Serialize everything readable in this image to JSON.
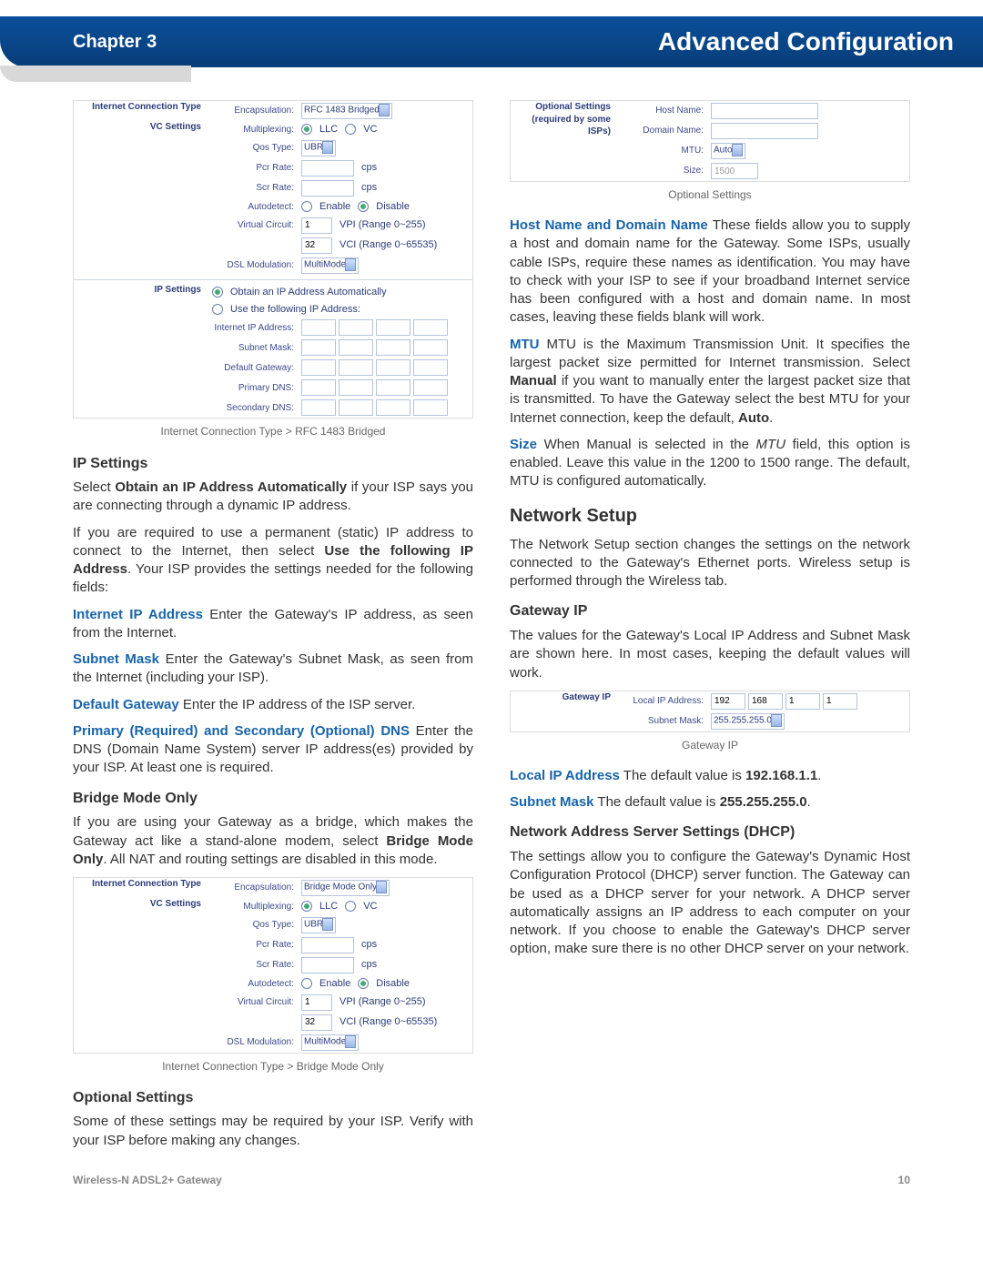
{
  "header": {
    "chapter": "Chapter 3",
    "title": "Advanced Configuration"
  },
  "fig1": {
    "side1": "Internet Connection Type",
    "side2": "VC Settings",
    "side3": "IP Settings",
    "encap_l": "Encapsulation:",
    "encap_v": "RFC 1483 Bridged",
    "mux_l": "Multiplexing:",
    "mux_llc": "LLC",
    "mux_vc": "VC",
    "qos_l": "Qos Type:",
    "qos_v": "UBR",
    "pcr_l": "Pcr Rate:",
    "rate_u": "cps",
    "scr_l": "Scr Rate:",
    "auto_l": "Autodetect:",
    "enable": "Enable",
    "disable": "Disable",
    "vc_l": "Virtual Circuit:",
    "vpi": "1",
    "vpi_r": "VPI (Range 0~255)",
    "vci": "32",
    "vci_r": "VCI (Range 0~65535)",
    "dsl_l": "DSL Modulation:",
    "dsl_v": "MultiMode",
    "obtain": "Obtain an IP Address Automatically",
    "usefollow": "Use the following IP Address:",
    "iip": "Internet IP Address:",
    "snm": "Subnet Mask:",
    "dgw": "Default Gateway:",
    "pdns": "Primary DNS:",
    "sdns": "Secondary DNS:"
  },
  "cap1": "Internet Connection Type > RFC 1483 Bridged",
  "h_ip": "IP Settings",
  "ip_p1a": "Select ",
  "ip_p1b": "Obtain an IP Address Automatically",
  "ip_p1c": " if your ISP says you are connecting through a dynamic IP address.",
  "ip_p2a": "If you are required to use a permanent (static) IP address to connect to the Internet, then select ",
  "ip_p2b": "Use the following IP Address",
  "ip_p2c": ". Your ISP provides the settings needed for the following fields:",
  "t_iip": "Internet IP Address",
  "d_iip": "  Enter the Gateway's IP address, as seen from the Internet.",
  "t_snm": "Subnet Mask",
  "d_snm": "  Enter the Gateway's Subnet Mask, as seen from the Internet (including your ISP).",
  "t_dgw": "Default Gateway",
  "d_dgw": "  Enter the IP address of the ISP server.",
  "t_dns": "Primary (Required) and Secondary (Optional) DNS",
  "d_dns": "  Enter the DNS (Domain Name System) server IP address(es) provided by your ISP. At least one is required.",
  "h_bmo": "Bridge Mode Only",
  "bmo_p1a": "If you are using your Gateway as a bridge, which makes the Gateway act like a stand-alone modem, select ",
  "bmo_p1b": "Bridge Mode Only",
  "bmo_p1c": ". All NAT and routing settings are disabled in this mode.",
  "fig2": {
    "encap_v": "Bridge Mode Only"
  },
  "cap2": "Internet Connection Type > Bridge Mode Only",
  "h_opt": "Optional Settings",
  "opt_p": "Some of these settings may be required by your ISP. Verify with your ISP before making any changes.",
  "fig3": {
    "side": "Optional Settings (required by some ISPs)",
    "hn": "Host Name:",
    "dn": "Domain Name:",
    "mtu": "MTU:",
    "mtu_v": "Auto",
    "size": "Size:",
    "size_v": "1500"
  },
  "cap3": "Optional Settings",
  "t_hdn": "Host Name and Domain Name",
  "d_hdn": "  These fields allow you to supply a host and domain name for the Gateway. Some ISPs, usually cable ISPs, require these names as identification. You may have to check with your ISP to see if your broadband Internet service has been configured with a host and domain name. In most cases, leaving these fields blank will work.",
  "t_mtu": "MTU",
  "d_mtu_a": "  MTU is the Maximum Transmission Unit. It specifies the largest packet size permitted for Internet transmission. Select ",
  "d_mtu_b": "Manual",
  "d_mtu_c": " if you want to manually enter the largest packet size that is transmitted. To have the Gateway select the best MTU for your Internet connection, keep the default, ",
  "d_mtu_d": "Auto",
  "d_mtu_e": ".",
  "t_size": "Size",
  "d_size_a": "  When Manual is selected in the ",
  "d_size_i": "MTU",
  "d_size_b": " field, this option is enabled. Leave this value in the 1200 to 1500 range. The default, MTU is configured automatically.",
  "h_net": "Network Setup",
  "net_p": "The Network Setup section changes the settings on the network connected to the Gateway's Ethernet ports. Wireless setup is performed through the Wireless tab.",
  "h_gip": "Gateway IP",
  "gip_p": "The values for the Gateway's Local IP Address and Subnet Mask are shown here. In most cases, keeping the default values will work.",
  "fig4": {
    "side": "Gateway IP",
    "lip": "Local IP Address:",
    "lip_a": "192",
    "lip_b": "168",
    "lip_c": "1",
    "lip_d": "1",
    "snm": "Subnet Mask:",
    "snm_v": "255.255.255.0"
  },
  "cap4": "Gateway IP",
  "t_lip": "Local IP Address",
  "d_lip_a": "  The default value is ",
  "d_lip_b": "192.168.1.1",
  "d_lip_c": ".",
  "t_snm2": "Subnet Mask",
  "d_snm2_a": "  The default value is ",
  "d_snm2_b": "255.255.255.0",
  "d_snm2_c": ".",
  "h_dhcp": "Network Address Server Settings (DHCP)",
  "dhcp_p": "The settings allow you to configure the Gateway's Dynamic Host Configuration Protocol (DHCP) server function. The Gateway can be used as a DHCP server for your network. A DHCP server automatically assigns an IP address to each computer on your network. If you choose to enable the Gateway's DHCP server option, make sure there is no other DHCP server on your network.",
  "footer": {
    "left": "Wireless-N ADSL2+ Gateway",
    "right": "10"
  }
}
